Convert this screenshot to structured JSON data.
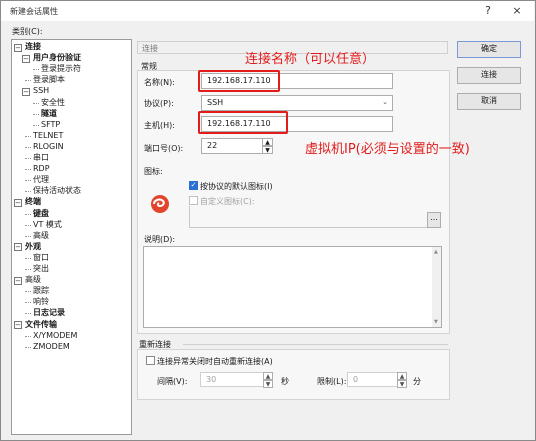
{
  "window": {
    "title": "新建会话属性",
    "help": "?",
    "close": "×"
  },
  "category_label": "类别(C):",
  "tree": [
    {
      "label": "连接",
      "level": 0,
      "bold": true,
      "expander": "−"
    },
    {
      "label": "用户身份验证",
      "level": 1,
      "bold": true,
      "expander": "−"
    },
    {
      "label": "登录提示符",
      "level": 2
    },
    {
      "label": "登录脚本",
      "level": 1
    },
    {
      "label": "SSH",
      "level": 1,
      "expander": "−"
    },
    {
      "label": "安全性",
      "level": 2
    },
    {
      "label": "隧道",
      "level": 2,
      "bold": true
    },
    {
      "label": "SFTP",
      "level": 2
    },
    {
      "label": "TELNET",
      "level": 1
    },
    {
      "label": "RLOGIN",
      "level": 1
    },
    {
      "label": "串口",
      "level": 1
    },
    {
      "label": "RDP",
      "level": 1
    },
    {
      "label": "代理",
      "level": 1
    },
    {
      "label": "保持活动状态",
      "level": 1
    },
    {
      "label": "终端",
      "level": 0,
      "bold": true,
      "expander": "−"
    },
    {
      "label": "键盘",
      "level": 1,
      "bold": true
    },
    {
      "label": "VT 模式",
      "level": 1
    },
    {
      "label": "高级",
      "level": 1
    },
    {
      "label": "外观",
      "level": 0,
      "bold": true,
      "expander": "−"
    },
    {
      "label": "窗口",
      "level": 1
    },
    {
      "label": "突出",
      "level": 1
    },
    {
      "label": "高级",
      "level": 0,
      "expander": "−"
    },
    {
      "label": "跟踪",
      "level": 1
    },
    {
      "label": "响铃",
      "level": 1
    },
    {
      "label": "日志记录",
      "level": 1,
      "bold": true
    },
    {
      "label": "文件传输",
      "level": 0,
      "bold": true,
      "expander": "−"
    },
    {
      "label": "X/YMODEM",
      "level": 1
    },
    {
      "label": "ZMODEM",
      "level": 1
    }
  ],
  "panel": {
    "header": "连接",
    "general_title": "常规",
    "name_label": "名称(N):",
    "name_value": "192.168.17.110",
    "protocol_label": "协议(P):",
    "protocol_value": "SSH",
    "host_label": "主机(H):",
    "host_value": "192.168.17.110",
    "port_label": "端口号(O):",
    "port_value": "22",
    "icon_label": "图标:",
    "default_icon_label": "按协议的默认图标(I)",
    "custom_icon_label": "自定义图标(C):",
    "browse_label": "...",
    "desc_label": "说明(D):",
    "reconnect_title": "重新连接",
    "reconnect_checkbox_label": "连接异常关闭时自动重新连接(A)",
    "interval_label": "间隔(V):",
    "interval_value": "30",
    "interval_unit": "秒",
    "limit_label": "限制(L):",
    "limit_value": "0",
    "limit_unit": "分"
  },
  "buttons": {
    "ok": "确定",
    "connect": "连接",
    "cancel": "取消"
  },
  "annotations": {
    "name_note": "连接名称（可以任意）",
    "host_note": "虚拟机IP(必须与设置的一致)"
  },
  "colors": {
    "annotation_red": "#e21b1b",
    "checkbox_blue": "#2a6fd6",
    "logo_red": "#e2452c"
  }
}
